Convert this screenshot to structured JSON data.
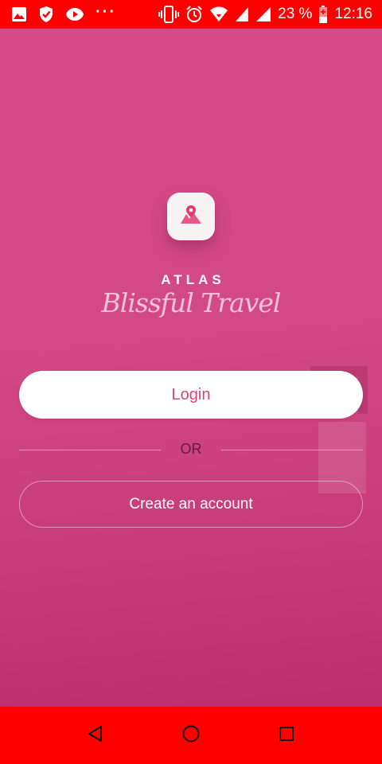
{
  "status_bar": {
    "overflow_dots": "···",
    "battery_percent": "23 %",
    "time": "12:16",
    "icons": [
      "image-icon",
      "shield-check-icon",
      "play-icon",
      "vibrate-icon",
      "alarm-icon",
      "wifi-icon",
      "signal-icon",
      "signal-icon",
      "battery-charging-icon"
    ]
  },
  "brand": {
    "logo_icon": "map-pin-icon",
    "name": "ATLAS",
    "tagline": "Blissful Travel"
  },
  "actions": {
    "login_label": "Login",
    "divider_text": "OR",
    "create_account_label": "Create an account"
  },
  "nav_bar": {
    "icons": [
      "back-icon",
      "home-icon",
      "recents-icon"
    ]
  },
  "colors": {
    "status_bar": "#ff0000",
    "nav_bar": "#ff0000",
    "background": "#d24985",
    "accent": "#d8457e",
    "tagline": "#f6c1d9",
    "divider_text": "#6a1a3e"
  }
}
